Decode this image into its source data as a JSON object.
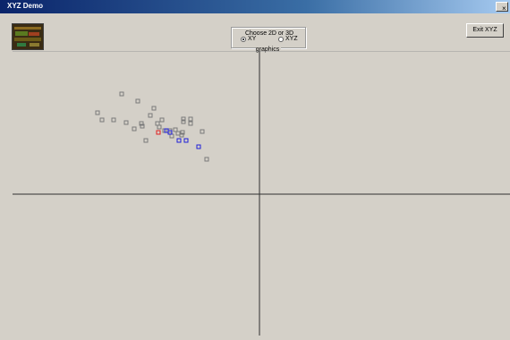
{
  "window": {
    "title": "XYZ Demo",
    "close_label": "×"
  },
  "controls": {
    "group_label": "Choose 2D or 3D graphics",
    "radio_xy": {
      "label": "XY",
      "checked": true
    },
    "radio_xyz": {
      "label": "XYZ",
      "checked": false
    },
    "exit_label": "Exit XYZ"
  },
  "icons": {
    "thumbnail": "thumbnail-image-icon",
    "close": "close-icon"
  },
  "colors": {
    "normal_point": "#7a7a7a",
    "red_point": "#e02020",
    "blue_point": "#2020d8",
    "plot_bg": "#d4d0c8",
    "grid_line": "#303030"
  },
  "scatter": {
    "normal": [
      [
        136,
        105
      ],
      [
        154,
        113
      ],
      [
        109,
        126
      ],
      [
        172,
        121
      ],
      [
        127,
        134
      ],
      [
        114,
        134
      ],
      [
        141,
        137
      ],
      [
        168,
        129
      ],
      [
        158,
        138
      ],
      [
        159,
        141
      ],
      [
        150,
        144
      ],
      [
        176,
        138
      ],
      [
        181,
        134
      ],
      [
        178,
        142
      ],
      [
        184,
        146
      ],
      [
        190,
        146
      ],
      [
        192,
        152
      ],
      [
        196,
        145
      ],
      [
        205,
        133
      ],
      [
        205,
        136
      ],
      [
        213,
        133
      ],
      [
        213,
        138
      ],
      [
        204,
        148
      ],
      [
        199,
        149
      ],
      [
        203,
        151
      ],
      [
        226,
        147
      ],
      [
        163,
        157
      ],
      [
        231,
        178
      ]
    ],
    "red": [
      [
        177,
        148
      ]
    ],
    "blue": [
      [
        186,
        146
      ],
      [
        190,
        148
      ],
      [
        200,
        157
      ],
      [
        208,
        157
      ],
      [
        222,
        164
      ]
    ]
  }
}
